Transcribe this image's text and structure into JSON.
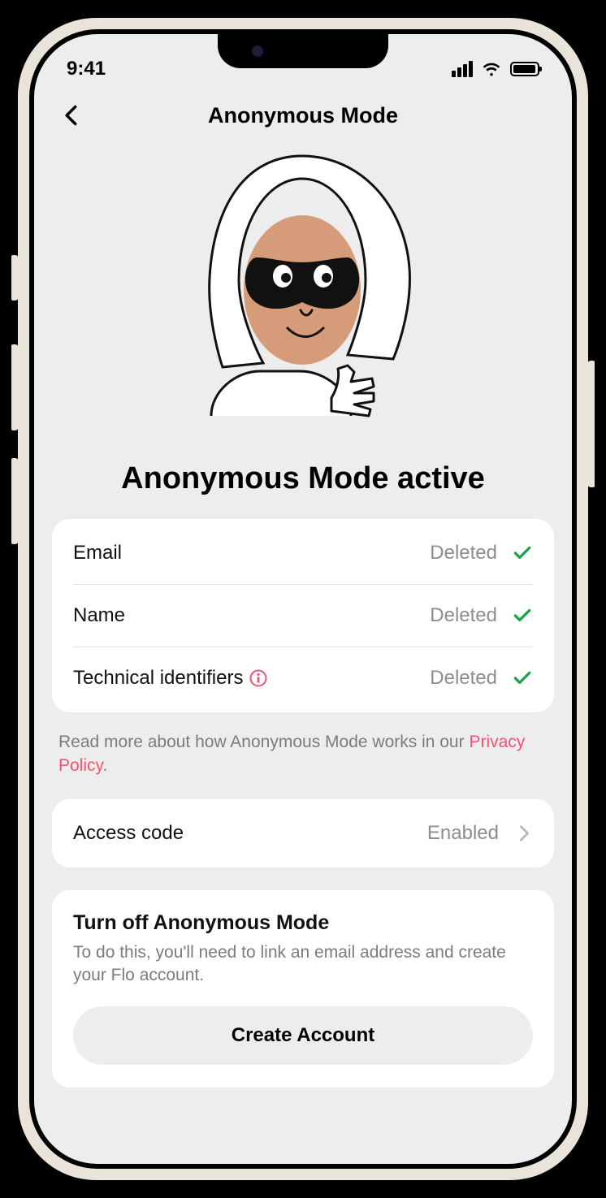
{
  "statusbar": {
    "time": "9:41"
  },
  "nav": {
    "title": "Anonymous Mode"
  },
  "main_title": "Anonymous Mode active",
  "rows": [
    {
      "label": "Email",
      "value": "Deleted"
    },
    {
      "label": "Name",
      "value": "Deleted"
    },
    {
      "label": "Technical identifiers",
      "value": "Deleted"
    }
  ],
  "footnote": {
    "before": "Read more about how Anonymous Mode works in our ",
    "link": "Privacy Policy",
    "after": "."
  },
  "access_row": {
    "label": "Access code",
    "value": "Enabled"
  },
  "turn_off": {
    "title": "Turn off Anonymous Mode",
    "sub": "To do this, you'll need to link an email address and create your Flo account.",
    "button": "Create Account"
  }
}
